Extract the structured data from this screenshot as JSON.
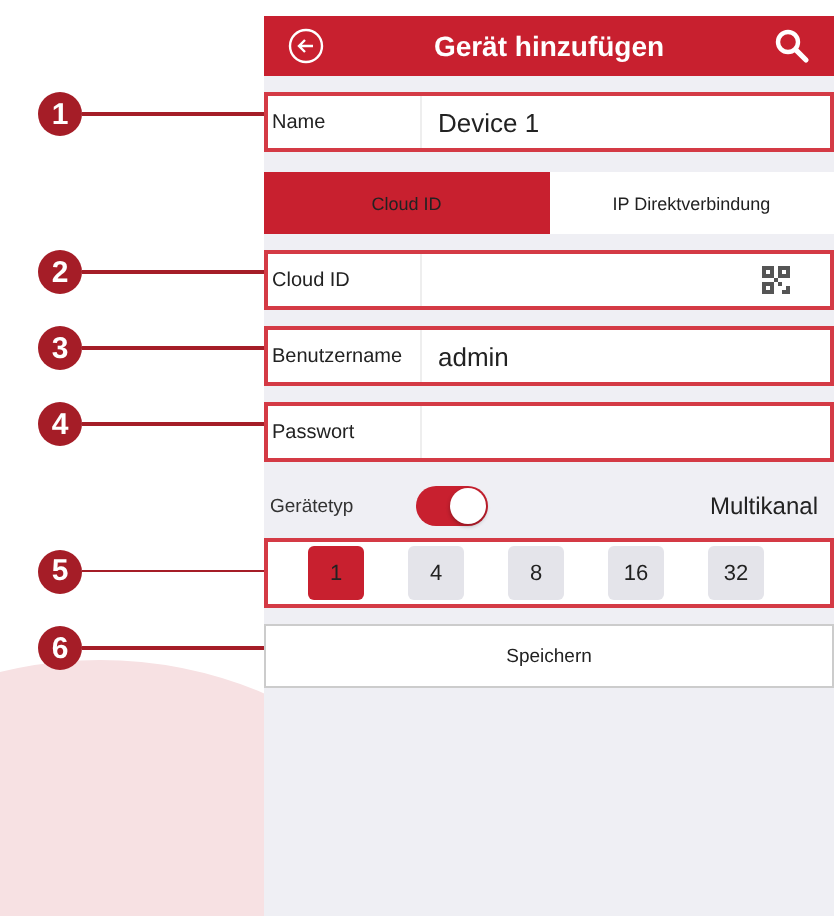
{
  "header": {
    "title": "Gerät hinzufügen"
  },
  "name_field": {
    "callout": "1",
    "label": "Name",
    "value": "Device 1"
  },
  "tabs": [
    {
      "label": "Cloud ID",
      "selected": true
    },
    {
      "label": "IP Direktverbindung",
      "selected": false
    }
  ],
  "fields": [
    {
      "callout": "2",
      "label": "Cloud ID",
      "kind": "qr"
    },
    {
      "callout": "3",
      "label": "Benutzername",
      "kind": "text",
      "value": "admin"
    },
    {
      "callout": "4",
      "label": "Passwort",
      "kind": "password"
    }
  ],
  "device_type": {
    "label": "Gerätetyp",
    "on": true,
    "value": "Multikanal"
  },
  "channels": {
    "callout": "5",
    "options": [
      {
        "label": "1",
        "selected": true
      },
      {
        "label": "4",
        "selected": false
      },
      {
        "label": "8",
        "selected": false
      },
      {
        "label": "16",
        "selected": false
      },
      {
        "label": "32",
        "selected": false
      }
    ]
  },
  "save": {
    "callout": "6",
    "label": "Speichern"
  }
}
